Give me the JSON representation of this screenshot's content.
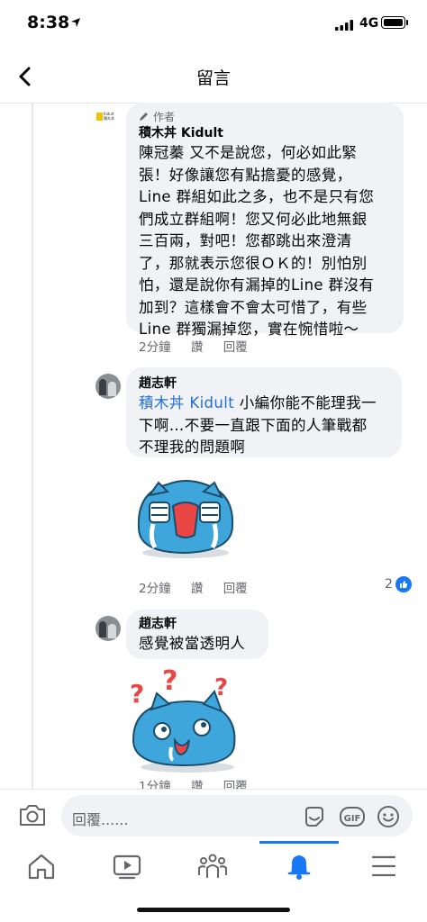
{
  "status_bar": {
    "time": "8:38",
    "network": "4G"
  },
  "header": {
    "title": "留言"
  },
  "comments": [
    {
      "badge": "作者",
      "author": "積木丼 Kidult",
      "text_lines": [
        "陳冠蓁 又不是說您，何必如此緊",
        "張！好像讓您有點擔憂的感覺，",
        "Line 群組如此之多，也不是只有您",
        "們成立群組啊！您又何必此地無銀",
        "三百兩，對吧！您都跳出來澄清",
        "了，那就表示您很ＯＫ的！別怕別",
        "怕，還是說你有漏掉的Line 群沒有",
        "加到？這樣會不會太可惜了，有些",
        "Line 群獨漏掉您，實在惋惜啦～"
      ],
      "time": "2分鐘",
      "like": "讚",
      "reply": "回覆"
    },
    {
      "author": "趙志軒",
      "mention": "積木丼 Kidult",
      "text_first": " 小編你能不能理我一",
      "text_lines": [
        "下啊…不要一直跟下面的人筆戰都",
        "不理我的問題啊"
      ],
      "time": "2分鐘",
      "like": "讚",
      "reply": "回覆",
      "reaction_count": "2"
    },
    {
      "author": "趙志軒",
      "text": "感覺被當透明人",
      "time": "1分鐘",
      "like": "讚",
      "reply": "回覆"
    }
  ],
  "reply_bar": {
    "placeholder": "回覆......"
  },
  "icons": {
    "back": "chevron-left-icon",
    "camera": "camera-icon",
    "sticker": "sticker-icon",
    "gif": "gif-icon",
    "emoji": "emoji-icon",
    "tabs": [
      "home-icon",
      "video-icon",
      "groups-icon",
      "notifications-icon",
      "menu-icon"
    ]
  },
  "colors": {
    "accent": "#1877f2",
    "mention": "#216fdb",
    "bubble": "#f0f2f5",
    "sticker_blue": "#3fa6dc"
  }
}
